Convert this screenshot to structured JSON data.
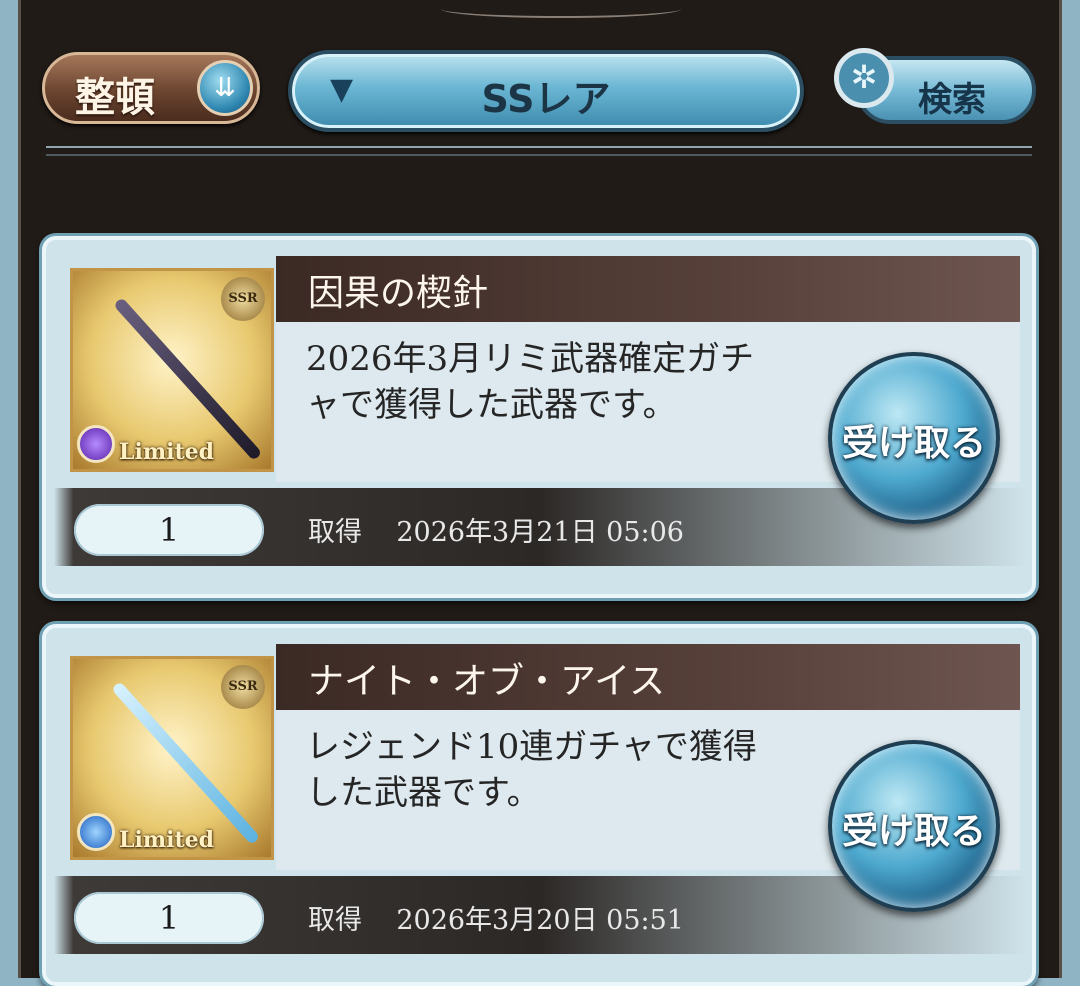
{
  "toolbar": {
    "sort_label": "整頓",
    "filter_value": "SSレア",
    "search_label": "検索"
  },
  "items": [
    {
      "name": "因果の楔針",
      "rarity": "SSR",
      "badge": "Limited",
      "element_color": "#7b3fc8",
      "weapon_color": "#2a2536",
      "description": "2026年3月リミ武器確定ガチャで獲得した武器です。",
      "quantity": "1",
      "acquired_label": "取得",
      "acquired_date": "2026年3月21日 05:06",
      "receive_label": "受け取る"
    },
    {
      "name": "ナイト・オブ・アイス",
      "rarity": "SSR",
      "badge": "Limited",
      "element_color": "#2a6fd0",
      "weapon_color": "#8ccdf0",
      "description": "レジェンド10連ガチャで獲得した武器です。",
      "quantity": "1",
      "acquired_label": "取得",
      "acquired_date": "2026年3月20日 05:51",
      "receive_label": "受け取る"
    }
  ]
}
